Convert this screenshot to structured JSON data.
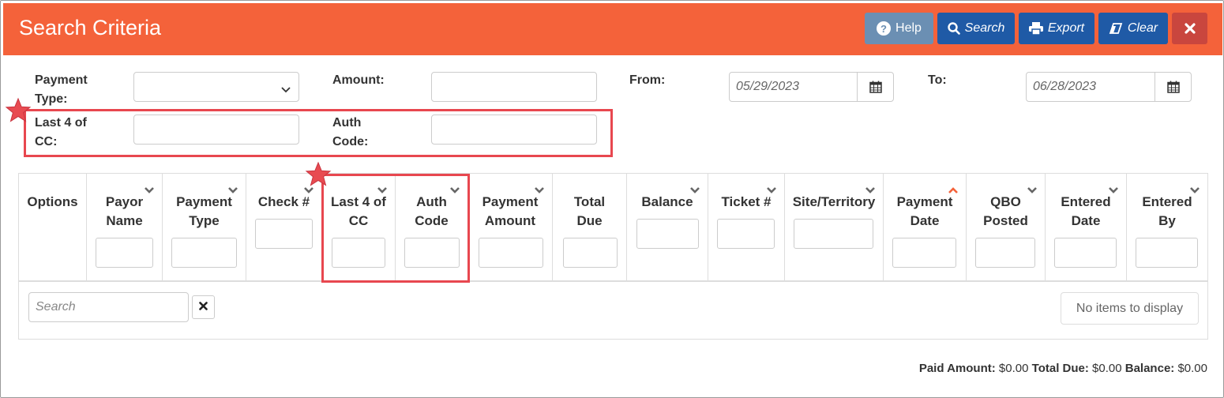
{
  "header": {
    "title": "Search Criteria",
    "buttons": {
      "help": "Help",
      "search": "Search",
      "export": "Export",
      "clear": "Clear"
    },
    "color": "#f4623a"
  },
  "criteria": {
    "payment_type_label_1": "Payment",
    "payment_type_label_2": "Type:",
    "payment_type_value": "",
    "amount_label": "Amount:",
    "amount_value": "",
    "from_label": "From:",
    "from_value": "05/29/2023",
    "to_label": "To:",
    "to_value": "06/28/2023",
    "last4_label_1": "Last 4 of",
    "last4_label_2": "CC:",
    "last4_value": "",
    "auth_label_1": "Auth",
    "auth_label_2": "Code:",
    "auth_value": ""
  },
  "grid": {
    "columns": [
      {
        "line1": "Options",
        "line2": ""
      },
      {
        "line1": "Payor",
        "line2": "Name"
      },
      {
        "line1": "Payment",
        "line2": "Type"
      },
      {
        "line1": "Check #",
        "line2": ""
      },
      {
        "line1": "Last 4 of",
        "line2": "CC"
      },
      {
        "line1": "Auth",
        "line2": "Code"
      },
      {
        "line1": "Payment",
        "line2": "Amount"
      },
      {
        "line1": "Total",
        "line2": "Due"
      },
      {
        "line1": "Balance",
        "line2": ""
      },
      {
        "line1": "Ticket #",
        "line2": ""
      },
      {
        "line1": "Site/Territory",
        "line2": ""
      },
      {
        "line1": "Payment",
        "line2": "Date"
      },
      {
        "line1": "QBO",
        "line2": "Posted"
      },
      {
        "line1": "Entered",
        "line2": "Date"
      },
      {
        "line1": "Entered",
        "line2": "By"
      }
    ],
    "search_placeholder": "Search",
    "no_items": "No items to display"
  },
  "totals": {
    "paid_label": "Paid Amount:",
    "paid_value": "$0.00",
    "due_label": "Total Due:",
    "due_value": "$0.00",
    "balance_label": "Balance:",
    "balance_value": "$0.00"
  },
  "highlight_color": "#e8474f",
  "sort_indicator_color": "#f4623a"
}
